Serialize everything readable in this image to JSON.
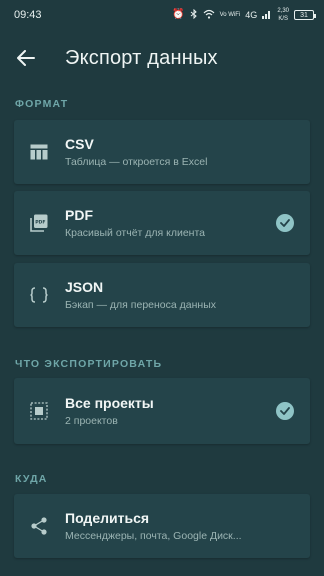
{
  "status_bar": {
    "time": "09:43",
    "net_speed_top": "2,30",
    "net_speed_bottom": "K/S",
    "signal_label": "4G",
    "wifi_label": "Vo WiFi",
    "battery": "31",
    "icons": [
      "alarm-icon",
      "bluetooth-icon",
      "wifi-icon",
      "signal-icon",
      "battery-icon"
    ]
  },
  "app_bar": {
    "back_icon": "arrow-left-icon",
    "title": "Экспорт данных"
  },
  "sections": {
    "format": "ФОРМАТ",
    "what": "ЧТО ЭКСПОРТИРОВАТЬ",
    "where": "КУДА"
  },
  "formats": [
    {
      "name": "CSV",
      "desc": "Таблица — откроется в Excel",
      "icon": "table-icon",
      "selected": false
    },
    {
      "name": "PDF",
      "desc": "Красивый отчёт для клиента",
      "icon": "pdf-icon",
      "selected": true
    },
    {
      "name": "JSON",
      "desc": "Бэкап — для переноса данных",
      "icon": "braces-icon",
      "selected": false
    }
  ],
  "scope": {
    "name": "Все проекты",
    "desc": "2 проектов",
    "icon": "select-all-icon",
    "selected": true
  },
  "destination": {
    "name": "Поделиться",
    "desc": "Мессенджеры, почта, Google Диск...",
    "icon": "share-icon"
  },
  "colors": {
    "background": "#1f3a3f",
    "card": "#24444a",
    "accent": "#8fc4c6",
    "section_label": "#6fa6a8"
  }
}
